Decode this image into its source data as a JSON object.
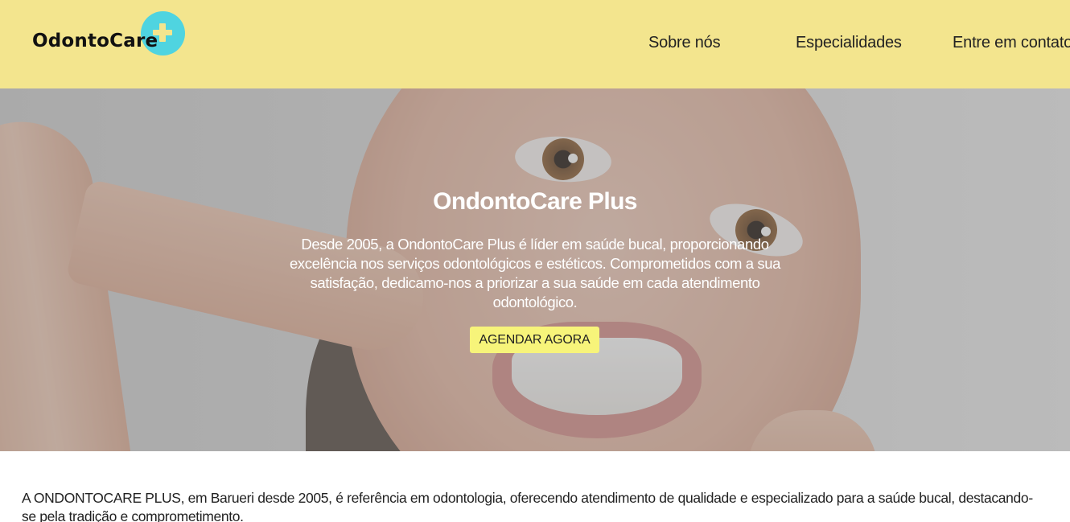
{
  "header": {
    "logo_text": "OdontoCare",
    "nav": [
      {
        "label": "Sobre nós"
      },
      {
        "label": "Especialidades"
      },
      {
        "label": "Entre em contato"
      }
    ]
  },
  "hero": {
    "title": "OndontoCare Plus",
    "description": "Desde 2005, a OndontoCare Plus é líder em saúde bucal, proporcionando excelência nos serviços odontológicos e estéticos. Comprometidos com a sua satisfação, dedicamo-nos a priorizar a sua saúde em cada atendimento odontológico.",
    "cta_label": "AGENDAR AGORA"
  },
  "about": {
    "text": "A ONDONTOCARE PLUS, em Barueri desde 2005, é referência em odontologia, oferecendo atendimento de qualidade e especializado para a saúde bucal, destacando-se pela tradição e comprometimento."
  },
  "colors": {
    "header_bg": "#f3e58e",
    "logo_accent": "#4fd4e0",
    "cta_bg": "#f7f47a"
  },
  "icons": {
    "logo_mark": "plus-circle-icon"
  }
}
